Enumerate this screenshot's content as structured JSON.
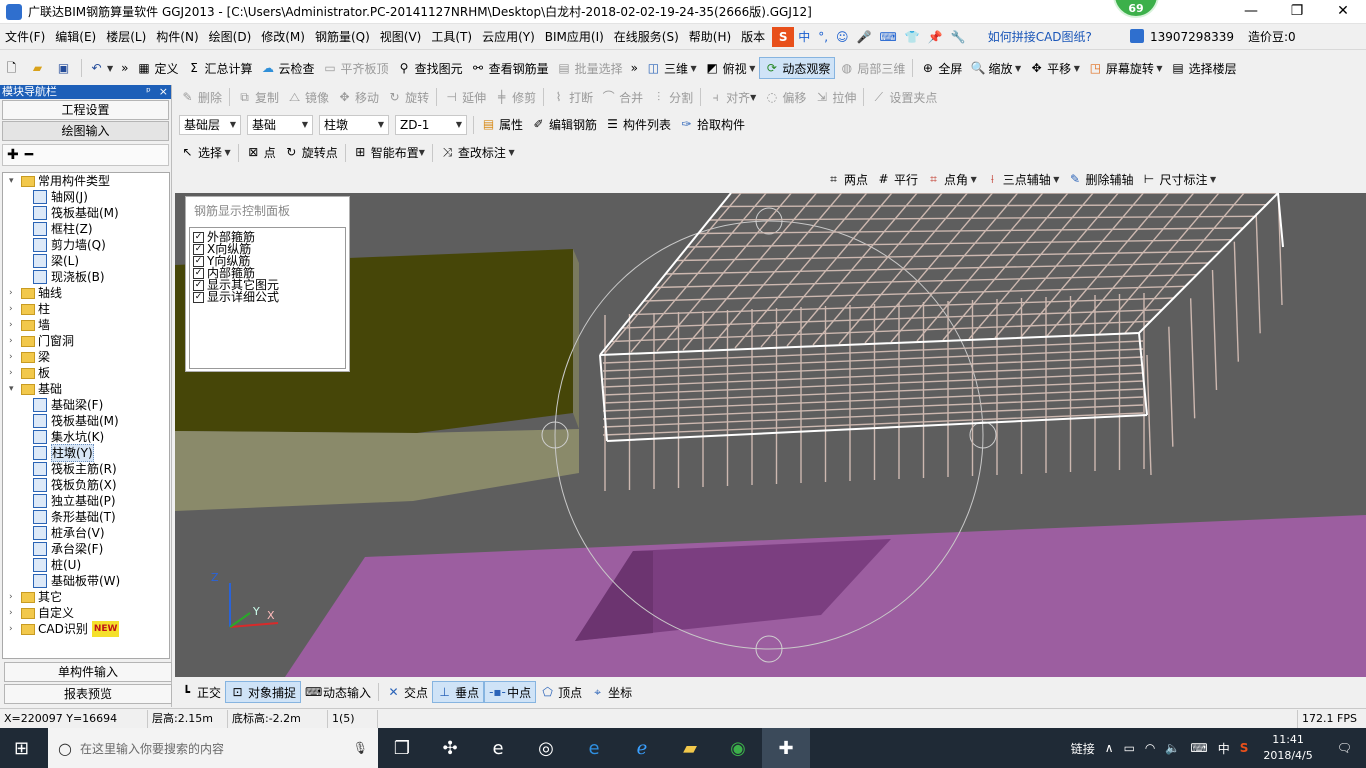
{
  "window": {
    "title": "广联达BIM钢筋算量软件 GGJ2013 - [C:\\Users\\Administrator.PC-20141127NRHM\\Desktop\\白龙村-2018-02-02-19-24-35(2666版).GGJ12]",
    "badge": "69",
    "minimize": "—",
    "maximize": "❐",
    "close": "✕"
  },
  "menu": [
    "文件(F)",
    "编辑(E)",
    "楼层(L)",
    "构件(N)",
    "绘图(D)",
    "修改(M)",
    "钢筋量(Q)",
    "视图(V)",
    "工具(T)",
    "云应用(Y)",
    "BIM应用(I)",
    "在线服务(S)",
    "帮助(H)",
    "版本"
  ],
  "ime": {
    "s": "S",
    "cn": "中",
    "punct": "°,",
    "emoji": "☺",
    "mic": "🎤",
    "kbd": "⌨",
    "shirt": "👕",
    "pin": "📌",
    "wrench": "🔧"
  },
  "cad_link": "如何拼接CAD图纸?",
  "account": {
    "phone": "13907298339",
    "coins": "造价豆:0"
  },
  "toolbar1": {
    "define": "定义",
    "sum": "汇总计算",
    "cloud_check": "云检查",
    "flat_top": "平齐板顶",
    "find": "查找图元",
    "view_rebar": "查看钢筋量",
    "batch": "批量选择",
    "view3d": "三维",
    "top_view": "俯视",
    "dynamic": "动态观察",
    "local3d": "局部三维",
    "full": "全屏",
    "zoom": "缩放",
    "pan": "平移",
    "rotate": "屏幕旋转",
    "select_floor": "选择楼层"
  },
  "toolbar2": {
    "delete": "删除",
    "copy": "复制",
    "mirror": "镜像",
    "move": "移动",
    "rotate": "旋转",
    "extend": "延伸",
    "trim": "修剪",
    "break": "打断",
    "merge": "合并",
    "split": "分割",
    "align": "对齐",
    "offset": "偏移",
    "stretch": "拉伸",
    "grip": "设置夹点"
  },
  "toolbar3": {
    "floor": "基础层",
    "category": "基础",
    "type": "柱墩",
    "item": "ZD-1",
    "props": "属性",
    "edit_rebar": "编辑钢筋",
    "list": "构件列表",
    "pick": "拾取构件"
  },
  "toolbar4": {
    "select": "选择",
    "point": "点",
    "rot_point": "旋转点",
    "smart": "智能布置",
    "check": "查改标注"
  },
  "toolbar5": {
    "two_pts": "两点",
    "parallel": "平行",
    "pt_angle": "点角",
    "three_axis": "三点辅轴",
    "del_axis": "删除辅轴",
    "dim": "尺寸标注"
  },
  "nav": {
    "header": "模块导航栏",
    "pin": "ᵖ",
    "close": "×",
    "project": "工程设置",
    "draw": "绘图输入",
    "single": "单构件输入",
    "report": "报表预览"
  },
  "tree": [
    {
      "level": 0,
      "exp": "▾",
      "folder": true,
      "label": "常用构件类型"
    },
    {
      "level": 1,
      "label": "轴网(J)"
    },
    {
      "level": 1,
      "label": "筏板基础(M)"
    },
    {
      "level": 1,
      "label": "框柱(Z)"
    },
    {
      "level": 1,
      "label": "剪力墙(Q)"
    },
    {
      "level": 1,
      "label": "梁(L)"
    },
    {
      "level": 1,
      "label": "现浇板(B)"
    },
    {
      "level": 0,
      "exp": "›",
      "folder": true,
      "label": "轴线"
    },
    {
      "level": 0,
      "exp": "›",
      "folder": true,
      "label": "柱"
    },
    {
      "level": 0,
      "exp": "›",
      "folder": true,
      "label": "墙"
    },
    {
      "level": 0,
      "exp": "›",
      "folder": true,
      "label": "门窗洞"
    },
    {
      "level": 0,
      "exp": "›",
      "folder": true,
      "label": "梁"
    },
    {
      "level": 0,
      "exp": "›",
      "folder": true,
      "label": "板"
    },
    {
      "level": 0,
      "exp": "▾",
      "folder": true,
      "label": "基础"
    },
    {
      "level": 1,
      "label": "基础梁(F)"
    },
    {
      "level": 1,
      "label": "筏板基础(M)"
    },
    {
      "level": 1,
      "label": "集水坑(K)"
    },
    {
      "level": 1,
      "label": "柱墩(Y)",
      "selected": true
    },
    {
      "level": 1,
      "label": "筏板主筋(R)"
    },
    {
      "level": 1,
      "label": "筏板负筋(X)"
    },
    {
      "level": 1,
      "label": "独立基础(P)"
    },
    {
      "level": 1,
      "label": "条形基础(T)"
    },
    {
      "level": 1,
      "label": "桩承台(V)"
    },
    {
      "level": 1,
      "label": "承台梁(F)"
    },
    {
      "level": 1,
      "label": "桩(U)"
    },
    {
      "level": 1,
      "label": "基础板带(W)"
    },
    {
      "level": 0,
      "exp": "›",
      "folder": true,
      "label": "其它"
    },
    {
      "level": 0,
      "exp": "›",
      "folder": true,
      "label": "自定义"
    },
    {
      "level": 0,
      "exp": "›",
      "folder": true,
      "label": "CAD识别",
      "new": "NEW"
    }
  ],
  "rebar_panel": {
    "title": "钢筋显示控制面板",
    "items": [
      "外部箍筋",
      "X向纵筋",
      "Y向纵筋",
      "内部箍筋",
      "显示其它图元",
      "显示详细公式"
    ]
  },
  "axes": {
    "z": "Z",
    "y": "Y",
    "x": "X"
  },
  "snap": {
    "ortho": "正交",
    "osnap": "对象捕捉",
    "dyn": "动态输入",
    "inter": "交点",
    "perp": "垂点",
    "mid": "中点",
    "vertex": "顶点",
    "coord": "坐标"
  },
  "status": {
    "coords": "X=220097 Y=16694",
    "floor_h": "层高:2.15m",
    "base_h": "底标高:-2.2m",
    "count": "1(5)",
    "fps": "172.1 FPS"
  },
  "taskbar": {
    "search": "在这里输入你要搜索的内容",
    "link": "链接",
    "time": "11:41",
    "date": "2018/4/5",
    "lang": "中"
  },
  "colors": {
    "title_blue": "#1d5fb8",
    "viewport": "#5e5e5e",
    "olive": "#4a4a0d",
    "purple": "#9a5ea0"
  }
}
